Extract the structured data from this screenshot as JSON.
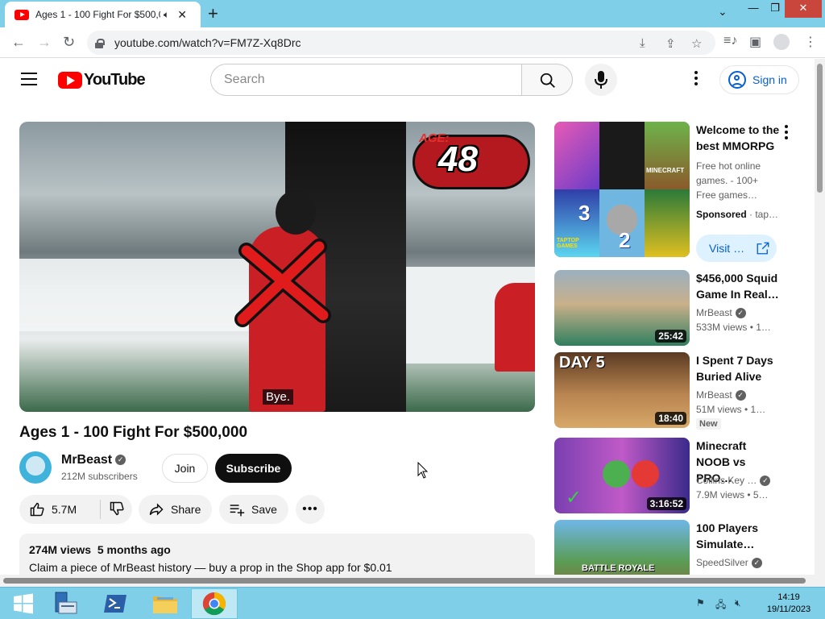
{
  "browser": {
    "tab_title": "Ages 1 - 100 Fight For $500,0",
    "audio_icon": "speaker-icon",
    "url": "youtube.com/watch?v=FM7Z-Xq8Drc",
    "window_controls": {
      "minimize": "—",
      "maximize": "❐",
      "close": "✕"
    }
  },
  "youtube": {
    "logo_text": "YouTube",
    "search_placeholder": "Search",
    "signin_label": "Sign in",
    "brand_color": "#ff0000",
    "link_color": "#065fd4"
  },
  "video": {
    "overlay_age_label": "AGE:",
    "overlay_age_value": "48",
    "caption": "Bye.",
    "title": "Ages 1 - 100 Fight For $500,000",
    "channel_name": "MrBeast",
    "subscribers": "212M subscribers",
    "join_label": "Join",
    "subscribe_label": "Subscribe",
    "likes": "5.7M",
    "share_label": "Share",
    "save_label": "Save",
    "more_label": "•••",
    "views": "274M views",
    "age": "5 months ago",
    "description": "Claim a piece of MrBeast history — buy a prop in the Shop app for $0.01"
  },
  "sidebar": {
    "ad": {
      "title": "Welcome to the best MMORPG",
      "description": "Free hot online games. - 100+ Free games…",
      "sponsored_label": "Sponsored",
      "advertiser": "· tap…",
      "visit_label": "Visit …",
      "thumb_texts": [
        "MINECRAFT",
        "3",
        "2",
        "TAPTOP GAMES"
      ]
    },
    "videos": [
      {
        "title": "$456,000 Squid Game In Real…",
        "channel": "MrBeast",
        "meta": "533M views  • 1…",
        "duration": "25:42",
        "badge": ""
      },
      {
        "title": "I Spent 7 Days Buried Alive",
        "channel": "MrBeast",
        "meta": "51M views  • 1…",
        "duration": "18:40",
        "badge": "New",
        "thumb_text": "DAY 5"
      },
      {
        "title": "Minecraft NOOB vs PRO…",
        "channel": "Collins Key …",
        "meta": "7.9M views  • 5…",
        "duration": "3:16:52",
        "badge": ""
      },
      {
        "title": "100 Players Simulate…",
        "channel": "SpeedSilver",
        "meta": "",
        "duration": "",
        "badge": "",
        "thumb_text": "BATTLE ROYALE"
      }
    ]
  },
  "taskbar": {
    "time": "14:19",
    "date": "19/11/2023"
  }
}
